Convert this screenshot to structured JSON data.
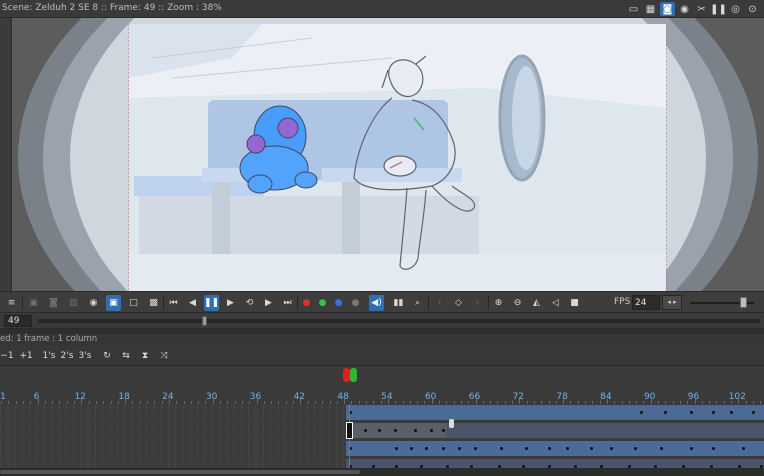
{
  "viewer": {
    "scene_label": "Scene: Zelduh 2 SE 8",
    "frame_label": "Frame: 49",
    "zoom_label": "Zoom : 38%",
    "separator": "::",
    "icons": [
      "monitor-icon",
      "grid-icon",
      "onion-skin-icon",
      "camera-icon",
      "clapper-icon",
      "pause-icon",
      "eye-icon",
      "eye-settings-icon"
    ]
  },
  "player": {
    "fps_label": "FPS",
    "fps_value": "24",
    "playing": true,
    "speed_fraction": 0.88
  },
  "scrub": {
    "frame_value": "49"
  },
  "timeline": {
    "info": "ed: 1 frame : 1 column",
    "buttons": [
      "−1",
      "+1",
      "1's",
      "2's",
      "3's"
    ],
    "ruler_labels": [
      "1",
      "6",
      "12",
      "18",
      "24",
      "30",
      "36",
      "42",
      "48",
      "54",
      "60",
      "66",
      "72",
      "78",
      "84",
      "90",
      "96",
      "102"
    ],
    "current_frame": 49
  },
  "colors": {
    "accent": "#2f6fb3",
    "ruler_text": "#7ab0e0",
    "track_blue": "#4b6a96",
    "track_gray": "#5a5e66",
    "playhead": "#ff4040"
  }
}
